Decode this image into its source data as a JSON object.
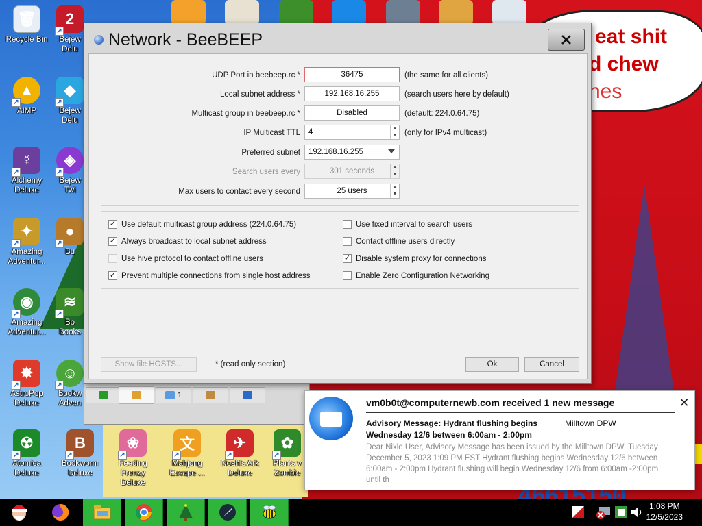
{
  "desktop": {
    "bubble_lines": [
      "eat shit",
      "d chew",
      "nes"
    ],
    "digits": "46615150",
    "icons": [
      {
        "label": "Recycle Bin",
        "name": "recycle-bin"
      },
      {
        "label": "Bejew\nDelu",
        "name": "bejeweled-deluxe"
      },
      {
        "label": "AIMP",
        "name": "aimp"
      },
      {
        "label": "Bejew\nDelu",
        "name": "bejeweled-2-deluxe"
      },
      {
        "label": "Alchemy\nDeluxe",
        "name": "alchemy-deluxe"
      },
      {
        "label": "Bejew\nTwi",
        "name": "bejeweled-twist"
      },
      {
        "label": "Amazing\nAdventur...",
        "name": "amazing-adventures-1"
      },
      {
        "label": "Bu",
        "name": "bu-app"
      },
      {
        "label": "Amazing\nAdventur...",
        "name": "amazing-adventures-2"
      },
      {
        "label": "Bo\nBooks",
        "name": "bookworm"
      },
      {
        "label": "AstroPop\nDeluxe",
        "name": "astropop-deluxe"
      },
      {
        "label": "Bookw\nAdven",
        "name": "bookworm-adventures"
      },
      {
        "label": "Atomica\nDeluxe",
        "name": "atomica-deluxe"
      },
      {
        "label": "Bookworm\nDeluxe",
        "name": "bookworm-deluxe"
      },
      {
        "label": "Feeding\nFrenzy Deluxe",
        "name": "feeding-frenzy-deluxe"
      },
      {
        "label": "Mahjong\nEscape ...",
        "name": "mahjong-escape"
      },
      {
        "label": "Noah's Ark\nDeluxe",
        "name": "noahs-ark-deluxe"
      },
      {
        "label": "Plants v\nZombie",
        "name": "plants-vs-zombies"
      }
    ]
  },
  "dialog": {
    "title": "Network - BeeBEEP",
    "fields": {
      "udp_port_label": "UDP Port in beebeep.rc *",
      "udp_port_value": "36475",
      "udp_port_note": "(the same for all clients)",
      "subnet_label": "Local subnet address *",
      "subnet_value": "192.168.16.255",
      "subnet_note": "(search users here by default)",
      "multicast_label": "Multicast group in beebeep.rc *",
      "multicast_value": "Disabled",
      "multicast_note": "(default: 224.0.64.75)",
      "ttl_label": "IP Multicast TTL",
      "ttl_value": "4",
      "ttl_note": "(only for IPv4 multicast)",
      "preferred_label": "Preferred subnet",
      "preferred_value": "192.168.16.255",
      "search_label": "Search users every",
      "search_value": "301 seconds",
      "max_label": "Max users to contact every second",
      "max_value": "25 users"
    },
    "checks_left": [
      {
        "label": "Use default multicast group address (224.0.64.75)",
        "checked": true,
        "disabled": false
      },
      {
        "label": "Always broadcast to local subnet address",
        "checked": true,
        "disabled": false
      },
      {
        "label": "Use hive protocol to contact offline users",
        "checked": false,
        "disabled": true
      },
      {
        "label": "Prevent multiple connections from single host address",
        "checked": true,
        "disabled": false
      }
    ],
    "checks_right": [
      {
        "label": "Use fixed interval to search users",
        "checked": false,
        "disabled": false
      },
      {
        "label": "Contact offline users directly",
        "checked": false,
        "disabled": false
      },
      {
        "label": "Disable system proxy for connections",
        "checked": true,
        "disabled": false
      },
      {
        "label": "Enable Zero Configuration Networking",
        "checked": false,
        "disabled": false
      }
    ],
    "show_hosts_label": "Show file HOSTS...",
    "readonly_note": "* (read only section)",
    "ok_label": "Ok",
    "cancel_label": "Cancel",
    "checkmark": "✓"
  },
  "tabs": [
    {
      "name": "tab-screen",
      "badge": ""
    },
    {
      "name": "tab-users",
      "badge": ""
    },
    {
      "name": "tab-chat",
      "badge": "1"
    },
    {
      "name": "tab-groups",
      "badge": ""
    },
    {
      "name": "tab-shares",
      "badge": ""
    }
  ],
  "notification": {
    "title": "vm0b0t@computernewb.com received 1 new message",
    "subject": "Advisory Message: Hydrant flushing begins",
    "sender": "Milltown DPW",
    "date_line": "Wednesday 12/6 between 6:00am - 2:00pm",
    "body": "Dear Nixle User, Advisory Message has been issued by the Milltown DPW. Tuesday December 5, 2023 1:09 PM EST Hydrant flushing begins Wednesday 12/6 between 6:00am - 2:00pm Hydrant flushing will begin Wednesday 12/6 from 6:00am -2:00pm until th",
    "close": "✕"
  },
  "taskbar": {
    "time": "1:08 PM",
    "date": "12/5/2023"
  },
  "colors": {
    "accent_green": "#2eb53a",
    "error_border": "#e06a6a"
  }
}
